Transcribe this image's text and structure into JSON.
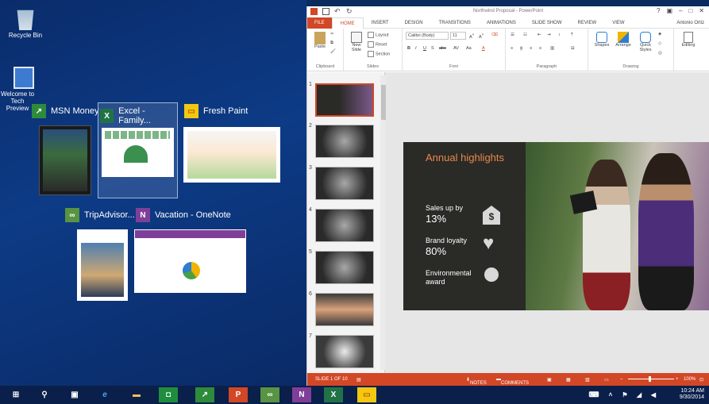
{
  "desktop": {
    "icons": [
      {
        "label": "Recycle Bin"
      },
      {
        "label": "Welcome to Tech Preview"
      }
    ]
  },
  "task_view": {
    "windows": [
      {
        "title": "MSN Money",
        "badge_color": "#2e8b3c",
        "icon": "chart-icon"
      },
      {
        "title": "Excel - Family...",
        "badge_color": "#217346",
        "icon": "excel-icon"
      },
      {
        "title": "Fresh Paint",
        "badge_color": "#f2c811",
        "icon": "fresh-paint-icon"
      },
      {
        "title": "TripAdvisor...",
        "badge_color": "#589442",
        "icon": "owl-icon"
      },
      {
        "title": "Vacation - OneNote",
        "badge_color": "#7f3f98",
        "icon": "onenote-icon"
      }
    ]
  },
  "powerpoint": {
    "doc_title": "Northwind Proposal - PowerPoint",
    "user": "Antonio Ortiz",
    "tabs": [
      "FILE",
      "HOME",
      "INSERT",
      "DESIGN",
      "TRANSITIONS",
      "ANIMATIONS",
      "SLIDE SHOW",
      "REVIEW",
      "VIEW"
    ],
    "active_tab": "HOME",
    "ribbon": {
      "paste": "Paste",
      "new_slide": "New Slide",
      "layout": "Layout",
      "reset": "Reset",
      "section": "Section",
      "font_name": "Calibri (Body)",
      "font_size": "11",
      "shapes": "Shapes",
      "arrange": "Arrange",
      "quick_styles": "Quick Styles",
      "editing": "Editing",
      "groups": [
        "Clipboard",
        "Slides",
        "Font",
        "Paragraph",
        "Drawing"
      ]
    },
    "slide_numbers": [
      "1",
      "2",
      "3",
      "4",
      "5",
      "6",
      "7"
    ],
    "selected_slide": 1,
    "slide": {
      "heading": "Annual highlights",
      "items": [
        {
          "text": "Sales up by",
          "value": "13%",
          "icon": "dollar-icon"
        },
        {
          "text": "Brand loyalty",
          "value": "80%",
          "icon": "heart-icon"
        },
        {
          "text": "Environmental award",
          "value": "",
          "icon": "award-icon"
        }
      ]
    },
    "status": {
      "slide_counter": "SLIDE 1 OF 10",
      "notes": "NOTES",
      "comments": "COMMENTS",
      "zoom": "100%"
    }
  },
  "taskbar": {
    "time": "10:24 AM",
    "date": "9/30/2014"
  },
  "colors": {
    "accent": "#d24726",
    "desktop": "#0d3b86",
    "taskbar": "#0a1f4a"
  }
}
